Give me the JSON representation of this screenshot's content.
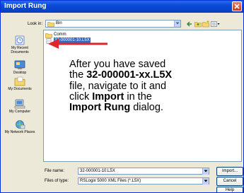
{
  "window": {
    "title": "Import Rung"
  },
  "lookin": {
    "label": "Look in:",
    "value": "Bin"
  },
  "places": [
    {
      "label": "My Recent Documents",
      "icon": "recent-documents-icon"
    },
    {
      "label": "Desktop",
      "icon": "desktop-icon"
    },
    {
      "label": "My Documents",
      "icon": "my-documents-icon"
    },
    {
      "label": "My Computer",
      "icon": "my-computer-icon"
    },
    {
      "label": "My Network Places",
      "icon": "network-places-icon"
    }
  ],
  "files": [
    {
      "name": "Comm",
      "type": "folder",
      "selected": false
    },
    {
      "name": "32-000001-10.L5X",
      "type": "file",
      "selected": true
    }
  ],
  "instructions": {
    "l1": "After you have saved",
    "l2a": "the ",
    "l2b": "32-000001-xx.L5X",
    "l3": "file, navigate to it and",
    "l4a": "click ",
    "l4b": "Import",
    "l4c": " in the",
    "l5a": "Import Rung",
    "l5b": " dialog."
  },
  "filename": {
    "label": "File name:",
    "value": "32-000001-10.L5X"
  },
  "filetype": {
    "label": "Files of type:",
    "value": "RSLogix 5000 XML Files (*.L5X)"
  },
  "buttons": {
    "import": "Import...",
    "cancel": "Cancel",
    "help": "Help"
  },
  "colors": {
    "titlebar": "#0a4ad8",
    "selection": "#316ac5",
    "arrow": "#e0262a"
  }
}
